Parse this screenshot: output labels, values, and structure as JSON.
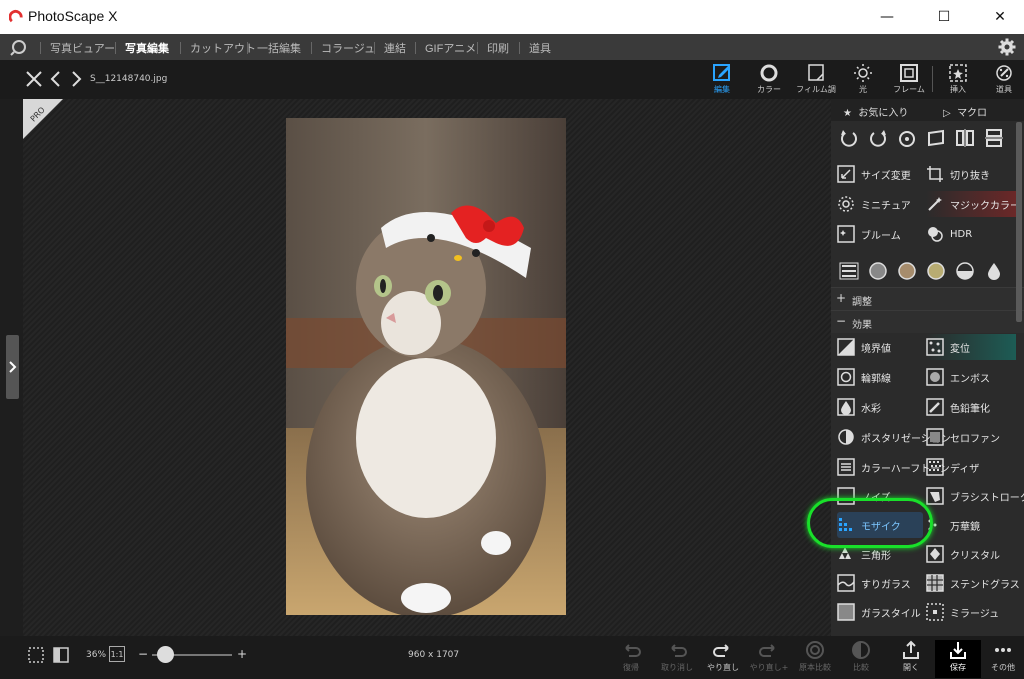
{
  "app": {
    "title": "PhotoScape X"
  },
  "window": {
    "minimize": "—",
    "maximize": "☐",
    "close": "✕"
  },
  "menu": {
    "items": [
      "写真ビュアー",
      "写真編集",
      "カットアウト",
      "一括編集",
      "コラージュ",
      "連結",
      "GIFアニメ",
      "印刷",
      "道具"
    ],
    "active": "写真編集"
  },
  "toolbar": {
    "filename": "S__12148740.jpg",
    "tools": [
      {
        "label": "編集",
        "icon": "edit-icon",
        "active": true
      },
      {
        "label": "カラー",
        "icon": "color-icon"
      },
      {
        "label": "フィルム調",
        "icon": "film-icon"
      },
      {
        "label": "光",
        "icon": "light-icon"
      },
      {
        "label": "フレーム",
        "icon": "frame-icon"
      },
      {
        "label": "挿入",
        "icon": "insert-icon"
      },
      {
        "label": "道具",
        "icon": "tools-icon"
      }
    ]
  },
  "canvas": {
    "badge": "PRO"
  },
  "panel": {
    "tabs": {
      "favorites": "お気に入り",
      "macro": "マクロ"
    },
    "transform_buttons": [
      "sizes",
      "crop"
    ],
    "row1": [
      {
        "left": "サイズ変更",
        "right": "切り抜き"
      },
      {
        "left": "ミニチュア",
        "right": "マジックカラー"
      },
      {
        "left": "ブルーム",
        "right": "HDR"
      }
    ],
    "sections": {
      "adjust": "調整",
      "effects": "効果",
      "adjust_sign": "+",
      "effects_sign": "−"
    },
    "effects": [
      {
        "left": "境界値",
        "right": "変位"
      },
      {
        "left": "輪郭線",
        "right": "エンボス"
      },
      {
        "left": "水彩",
        "right": "色鉛筆化"
      },
      {
        "left": "ポスタリゼーション",
        "right": "セロファン"
      },
      {
        "left": "カラーハーフトーン",
        "right": "ディザ"
      },
      {
        "left": "ノイズ",
        "right": "ブラシストローク"
      },
      {
        "left": "モザイク",
        "right": "万華鏡"
      },
      {
        "left": "三角形",
        "right": "クリスタル"
      },
      {
        "left": "すりガラス",
        "right": "ステンドグラス"
      },
      {
        "left": "ガラスタイル",
        "right": "ミラージュ"
      }
    ]
  },
  "status": {
    "zoom": "36%",
    "one_to_one": "1:1",
    "minus": "−",
    "plus": "+",
    "dimensions": "960 x 1707",
    "actions": [
      {
        "label": "復帰",
        "dim": true
      },
      {
        "label": "取り消し",
        "dim": true
      },
      {
        "label": "やり直し",
        "dim": false
      },
      {
        "label": "やり直し+",
        "dim": true
      },
      {
        "label": "原本比較",
        "dim": true
      },
      {
        "label": "比較",
        "dim": true
      },
      {
        "label": "開く",
        "dim": false
      },
      {
        "label": "保存",
        "dim": false
      },
      {
        "label": "その他",
        "dim": false
      }
    ]
  },
  "colors": {
    "accent": "#2aa4ff",
    "highlight": "#19e02a",
    "titlebar": "#ffffff",
    "menubar": "#3a3a3a"
  }
}
